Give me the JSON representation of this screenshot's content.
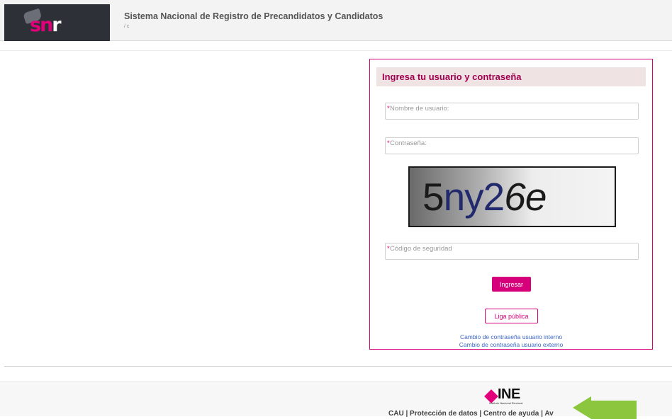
{
  "header": {
    "logo_text_pink": "sn",
    "logo_text_white": "r",
    "title": "Sistema Nacional de Registro de Precandidatos y Candidatos",
    "breadcrumb": "/ c"
  },
  "login": {
    "heading": "Ingresa tu usuario y contraseña",
    "required_mark": "*",
    "username_placeholder": "Nombre de usuario:",
    "password_placeholder": "Contraseña:",
    "captcha_part1": "5",
    "captcha_part2": "ny2",
    "captcha_part3": "6e",
    "security_code_placeholder": "Código de seguridad",
    "submit_label": "Ingresar",
    "public_link_label": "Liga pública",
    "link_internal": "Cambio de contraseña usuario interno",
    "link_external": "Cambio de contraseña usuario externo"
  },
  "footer": {
    "logo_word": "INE",
    "logo_sub": "Instituto Nacional Electoral",
    "links": [
      "CAU",
      "Protección de datos",
      "Centro de ayuda",
      "Av"
    ],
    "separator": " | "
  },
  "colors": {
    "brand_pink": "#d6007a",
    "header_dark": "#2e3038",
    "link_blue": "#3a66c8",
    "arrow_green": "#8cc63f"
  },
  "icons": {
    "arrow": "green-left-arrow-icon",
    "ine": "ine-diamond-icon"
  }
}
